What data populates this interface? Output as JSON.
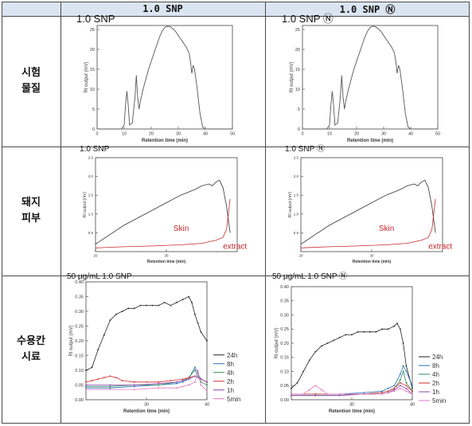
{
  "header": {
    "col1": "1.0 SNP",
    "col2": "1.0 SNP Ⓝ"
  },
  "rows": [
    {
      "label_lines": [
        "시험",
        "물질"
      ]
    },
    {
      "label_lines": [
        "돼지",
        "피부"
      ]
    },
    {
      "label_lines": [
        "수용칸",
        "시료"
      ]
    }
  ],
  "charts": [
    {
      "id": "test-left",
      "type": "line",
      "ylabel": "RI output (mV)",
      "xlabel": "Retention time (min)",
      "xlim": [
        0,
        50
      ],
      "ylim": [
        0,
        26
      ],
      "xticks": [
        "0",
        "10",
        "20",
        "30",
        "40",
        "50"
      ],
      "yticks": [
        "0",
        "5",
        "10",
        "15",
        "20",
        "25"
      ],
      "annotation": "1.0 SNP",
      "series": [
        {
          "color": "#555555",
          "x": [
            0,
            9,
            10,
            10.5,
            11,
            11.5,
            12,
            13,
            14,
            14.5,
            15,
            15.5,
            16,
            17,
            18,
            19,
            20,
            21,
            22,
            23,
            24,
            25,
            26,
            27,
            28,
            29,
            30,
            31,
            32,
            33,
            34,
            34.5,
            35,
            35.5,
            36,
            37,
            38,
            39,
            40,
            50
          ],
          "y": [
            0,
            0,
            1,
            6,
            9.5,
            6,
            1,
            1.5,
            8,
            13.5,
            8,
            5,
            7,
            10,
            12.5,
            15,
            17,
            19,
            21,
            23,
            24.5,
            25.5,
            25.8,
            25.7,
            25.2,
            24.5,
            23.5,
            22.5,
            21.5,
            20.5,
            19,
            17,
            14,
            16,
            15,
            10,
            4,
            0.5,
            0,
            0
          ]
        }
      ]
    },
    {
      "id": "test-right",
      "type": "line",
      "ylabel": "RI output (mV)",
      "xlabel": "Retention time (min)",
      "xlim": [
        0,
        50
      ],
      "ylim": [
        0,
        26
      ],
      "xticks": [
        "0",
        "10",
        "20",
        "30",
        "40",
        "50"
      ],
      "yticks": [
        "0",
        "5",
        "10",
        "15",
        "20",
        "25"
      ],
      "annotation": "1.0 SNP Ⓝ",
      "series": [
        {
          "color": "#555555",
          "x": [
            0,
            9,
            10,
            10.5,
            11,
            11.5,
            12,
            13,
            14,
            14.5,
            15,
            15.5,
            16,
            17,
            18,
            19,
            20,
            21,
            22,
            23,
            24,
            25,
            26,
            27,
            28,
            29,
            30,
            31,
            32,
            33,
            34,
            34.5,
            35,
            35.5,
            36,
            37,
            38,
            39,
            40,
            50
          ],
          "y": [
            0,
            0,
            1,
            6,
            9.5,
            6,
            1,
            1.5,
            8,
            13.5,
            8,
            5,
            7,
            10,
            12.5,
            15,
            17,
            19,
            21,
            23,
            24.5,
            25.5,
            25.8,
            25.7,
            25.2,
            24.5,
            23.5,
            22.5,
            21.5,
            20.5,
            19,
            17,
            14,
            16,
            15,
            10,
            4,
            0.5,
            0,
            0
          ]
        }
      ]
    },
    {
      "id": "skin-left",
      "type": "line",
      "ylabel": "RI output (mV)",
      "xlabel": "Retention time (min)",
      "xlim": [
        20,
        40
      ],
      "ylim": [
        0,
        2.5
      ],
      "xticks": [
        "20",
        "30"
      ],
      "xtickvals": [
        20,
        30
      ],
      "yticks": [
        "0.5",
        "1.0",
        "1.5",
        "2.0",
        "2.5"
      ],
      "ytickvals": [
        0.5,
        1.0,
        1.5,
        2.0,
        2.5
      ],
      "annotation": "1.0 SNP",
      "labels": {
        "skin": "Skin",
        "extract": "extract"
      },
      "series": [
        {
          "color": "#333333",
          "x": [
            20,
            22,
            24,
            26,
            28,
            30,
            32,
            34,
            35,
            36,
            36.5,
            37,
            37.5,
            38,
            38.5,
            39
          ],
          "y": [
            0.2,
            0.45,
            0.7,
            0.9,
            1.1,
            1.3,
            1.5,
            1.65,
            1.75,
            1.8,
            1.75,
            1.85,
            1.9,
            1.7,
            1.2,
            0.5
          ]
        },
        {
          "color": "#c62828",
          "x": [
            20,
            24,
            28,
            32,
            35,
            37,
            38,
            38.5,
            39
          ],
          "y": [
            0.1,
            0.13,
            0.15,
            0.18,
            0.22,
            0.3,
            0.38,
            0.6,
            1.4
          ]
        }
      ]
    },
    {
      "id": "skin-right",
      "type": "line",
      "ylabel": "RI output (mV)",
      "xlabel": "Retention time (min)",
      "xlim": [
        20,
        40
      ],
      "ylim": [
        0,
        2.5
      ],
      "xticks": [
        "20",
        "30"
      ],
      "xtickvals": [
        20,
        30
      ],
      "yticks": [
        "0.5",
        "1.0",
        "1.5",
        "2.0",
        "2.5"
      ],
      "ytickvals": [
        0.5,
        1.0,
        1.5,
        2.0,
        2.5
      ],
      "annotation": "1.0 SNP Ⓝ",
      "labels": {
        "skin": "Skin",
        "extract": "extract"
      },
      "series": [
        {
          "color": "#333333",
          "x": [
            20,
            22,
            24,
            26,
            28,
            30,
            32,
            34,
            35,
            36,
            36.5,
            37,
            37.5,
            38,
            38.5,
            39
          ],
          "y": [
            0.2,
            0.45,
            0.7,
            0.9,
            1.1,
            1.3,
            1.5,
            1.65,
            1.75,
            1.8,
            1.75,
            1.85,
            1.9,
            1.7,
            1.2,
            0.5
          ]
        },
        {
          "color": "#c62828",
          "x": [
            20,
            24,
            28,
            32,
            35,
            37,
            38,
            38.5,
            39
          ],
          "y": [
            0.1,
            0.13,
            0.15,
            0.18,
            0.22,
            0.3,
            0.38,
            0.6,
            1.4
          ]
        }
      ]
    },
    {
      "id": "recv-left",
      "type": "line",
      "ylabel": "RI output (mV)",
      "xlabel": "Retention time (min)",
      "xlim": [
        20,
        40
      ],
      "ylim": [
        0,
        0.4
      ],
      "xticks": [
        "30",
        "40"
      ],
      "xtickvals": [
        30,
        40
      ],
      "yticks": [
        "0.00",
        "0.05",
        "0.10",
        "0.15",
        "0.20",
        "0.25",
        "0.30",
        "0.35",
        "0.40"
      ],
      "ytickvals": [
        0,
        0.05,
        0.1,
        0.15,
        0.2,
        0.25,
        0.3,
        0.35,
        0.4
      ],
      "annotation": "50 μg/mL 1.0 SNP",
      "legend": [
        "24h",
        "8h",
        "4h",
        "2h",
        "1h",
        "5min"
      ],
      "series": [
        {
          "name": "24h",
          "color": "#222222",
          "x": [
            20,
            21,
            22,
            23,
            24,
            25,
            26,
            27,
            28,
            29,
            30,
            31,
            32,
            33,
            34,
            35,
            36,
            37,
            37.5,
            38,
            38.5,
            39,
            40
          ],
          "y": [
            0.1,
            0.11,
            0.17,
            0.22,
            0.27,
            0.29,
            0.3,
            0.31,
            0.31,
            0.32,
            0.32,
            0.32,
            0.32,
            0.33,
            0.32,
            0.33,
            0.34,
            0.35,
            0.33,
            0.29,
            0.26,
            0.23,
            0.2
          ]
        },
        {
          "name": "8h",
          "color": "#2a6fb5",
          "x": [
            20,
            24,
            28,
            32,
            35,
            36,
            37,
            37.5,
            38,
            38.5,
            39,
            40
          ],
          "y": [
            0.04,
            0.04,
            0.045,
            0.05,
            0.055,
            0.06,
            0.07,
            0.09,
            0.11,
            0.09,
            0.07,
            0.06
          ]
        },
        {
          "name": "4h",
          "color": "#2e8b57",
          "x": [
            20,
            24,
            28,
            32,
            35,
            36,
            37,
            37.5,
            38,
            38.5,
            39,
            40
          ],
          "y": [
            0.045,
            0.045,
            0.05,
            0.05,
            0.06,
            0.065,
            0.075,
            0.09,
            0.1,
            0.08,
            0.06,
            0.05
          ]
        },
        {
          "name": "2h",
          "color": "#d32f2f",
          "x": [
            20,
            21,
            22,
            23,
            24,
            25,
            26,
            28,
            30,
            32,
            34,
            36,
            37,
            38,
            39,
            40
          ],
          "y": [
            0.06,
            0.065,
            0.07,
            0.075,
            0.08,
            0.075,
            0.065,
            0.06,
            0.06,
            0.06,
            0.065,
            0.07,
            0.075,
            0.08,
            0.07,
            0.06
          ]
        },
        {
          "name": "1h",
          "color": "#8e44ad",
          "x": [
            20,
            24,
            28,
            32,
            35,
            36,
            37,
            38,
            39,
            40
          ],
          "y": [
            0.05,
            0.05,
            0.05,
            0.055,
            0.06,
            0.065,
            0.07,
            0.08,
            0.07,
            0.06
          ]
        },
        {
          "name": "5min",
          "color": "#e377c2",
          "x": [
            20,
            24,
            28,
            32,
            35,
            36,
            37,
            38,
            38.5,
            39,
            40
          ],
          "y": [
            0.035,
            0.035,
            0.035,
            0.04,
            0.04,
            0.045,
            0.05,
            0.06,
            0.1,
            0.05,
            0.03
          ]
        }
      ]
    },
    {
      "id": "recv-right",
      "type": "line",
      "ylabel": "RI output (mV)",
      "xlabel": "Retention time (min)",
      "xlim": [
        20,
        40
      ],
      "ylim": [
        0,
        0.4
      ],
      "xticks": [
        "30",
        "40"
      ],
      "xtickvals": [
        30,
        40
      ],
      "yticks": [
        "0.00",
        "0.05",
        "0.10",
        "0.15",
        "0.20",
        "0.25",
        "0.30",
        "0.35",
        "0.40"
      ],
      "ytickvals": [
        0,
        0.05,
        0.1,
        0.15,
        0.2,
        0.25,
        0.3,
        0.35,
        0.4
      ],
      "annotation": "50 μg/mL 1.0 SNP Ⓝ",
      "legend": [
        "24h",
        "8h",
        "4h",
        "2h",
        "1h",
        "5min"
      ],
      "series": [
        {
          "name": "24h",
          "color": "#222222",
          "x": [
            20,
            21,
            22,
            23,
            24,
            25,
            26,
            27,
            28,
            29,
            30,
            31,
            32,
            33,
            34,
            35,
            36,
            37,
            37.5,
            38,
            38.5,
            39,
            40
          ],
          "y": [
            0.04,
            0.06,
            0.1,
            0.14,
            0.17,
            0.19,
            0.2,
            0.21,
            0.22,
            0.23,
            0.23,
            0.24,
            0.24,
            0.24,
            0.24,
            0.25,
            0.25,
            0.26,
            0.27,
            0.25,
            0.2,
            0.12,
            0.04
          ]
        },
        {
          "name": "8h",
          "color": "#2a6fb5",
          "x": [
            20,
            24,
            28,
            32,
            35,
            36,
            37,
            38,
            38.5,
            39,
            40
          ],
          "y": [
            0.02,
            0.02,
            0.02,
            0.025,
            0.03,
            0.04,
            0.05,
            0.09,
            0.12,
            0.1,
            0.05
          ]
        },
        {
          "name": "4h",
          "color": "#2e8b57",
          "x": [
            20,
            24,
            28,
            32,
            35,
            36,
            37,
            38,
            38.5,
            39,
            40
          ],
          "y": [
            0.015,
            0.015,
            0.015,
            0.02,
            0.025,
            0.03,
            0.04,
            0.07,
            0.1,
            0.06,
            0.03
          ]
        },
        {
          "name": "2h",
          "color": "#d32f2f",
          "x": [
            20,
            24,
            28,
            32,
            35,
            36,
            37,
            38,
            39,
            40
          ],
          "y": [
            0.02,
            0.02,
            0.02,
            0.02,
            0.025,
            0.03,
            0.04,
            0.06,
            0.05,
            0.03
          ]
        },
        {
          "name": "1h",
          "color": "#8e44ad",
          "x": [
            20,
            24,
            28,
            32,
            35,
            36,
            37,
            38,
            39,
            40
          ],
          "y": [
            0.015,
            0.015,
            0.015,
            0.02,
            0.02,
            0.025,
            0.035,
            0.05,
            0.04,
            0.02
          ]
        },
        {
          "name": "5min",
          "color": "#e377c2",
          "x": [
            20,
            22,
            23,
            24,
            25,
            26,
            28,
            32,
            35,
            37,
            38,
            39,
            40
          ],
          "y": [
            0.02,
            0.02,
            0.035,
            0.05,
            0.035,
            0.02,
            0.02,
            0.02,
            0.02,
            0.03,
            0.04,
            0.03,
            0.02
          ]
        }
      ]
    }
  ]
}
